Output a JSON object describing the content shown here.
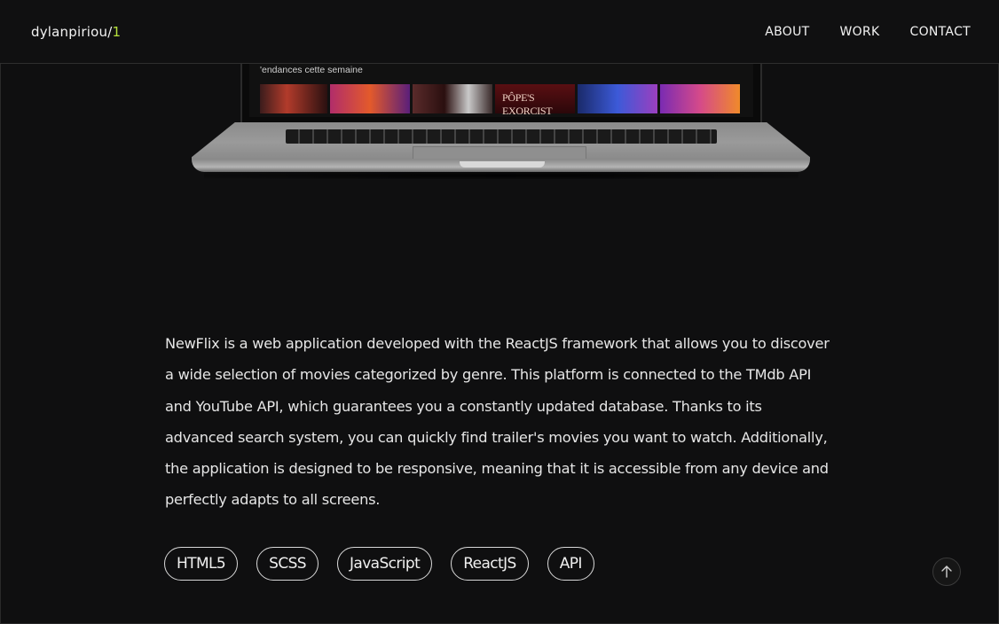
{
  "header": {
    "logo_name": "dylanpiriou",
    "logo_slash": "/",
    "logo_number": "1",
    "nav": [
      {
        "label": "ABOUT"
      },
      {
        "label": "WORK"
      },
      {
        "label": "CONTACT"
      }
    ]
  },
  "preview": {
    "trending_label": "'endances cette semaine",
    "poster_text": "PÔPE'S EXORCIST"
  },
  "project": {
    "description": "NewFlix is a web application developed with the ReactJS framework that allows you to discover a wide selection of movies categorized by genre. This platform is connected to the TMdb API and YouTube API, which guarantees you a constantly updated database. Thanks to its advanced search system, you can quickly find trailer's movies you want to watch. Additionally, the application is designed to be responsive, meaning that it is accessible from any device and perfectly adapts to all screens.",
    "tags": [
      "HTML5",
      "SCSS",
      "JavaScript",
      "ReactJS",
      "API"
    ]
  },
  "icons": {
    "scroll_top": "arrow-up-icon"
  },
  "colors": {
    "background": "#0f0f10",
    "accent": "#b6e13c",
    "text": "#e6e6e6"
  }
}
